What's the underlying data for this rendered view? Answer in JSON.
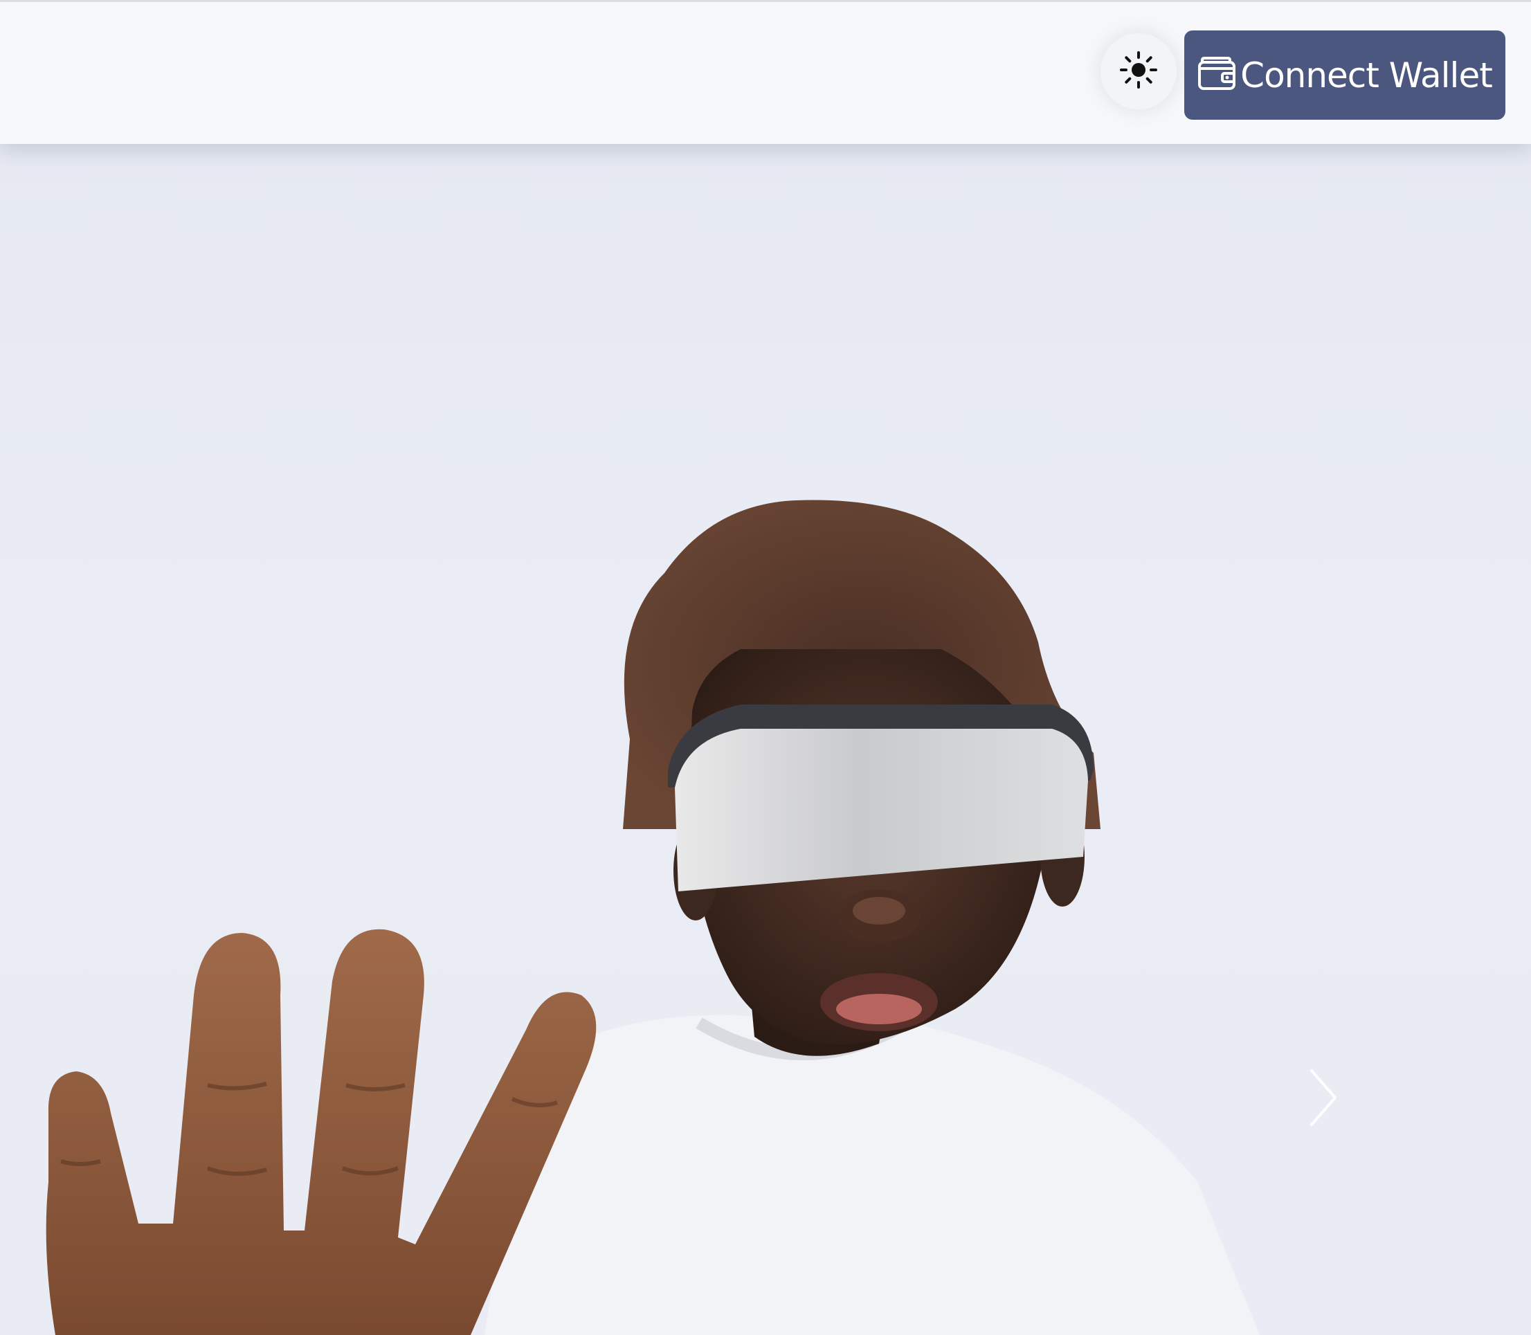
{
  "header": {
    "theme_toggle": {
      "icon": "sun-icon"
    },
    "connect_button": {
      "label": "Connect Wallet",
      "icon": "wallet-icon",
      "background": "#4b577f"
    }
  },
  "hero": {
    "image": "vr-headset-person-photo",
    "carousel": {
      "next_icon": "chevron-right-icon"
    }
  }
}
